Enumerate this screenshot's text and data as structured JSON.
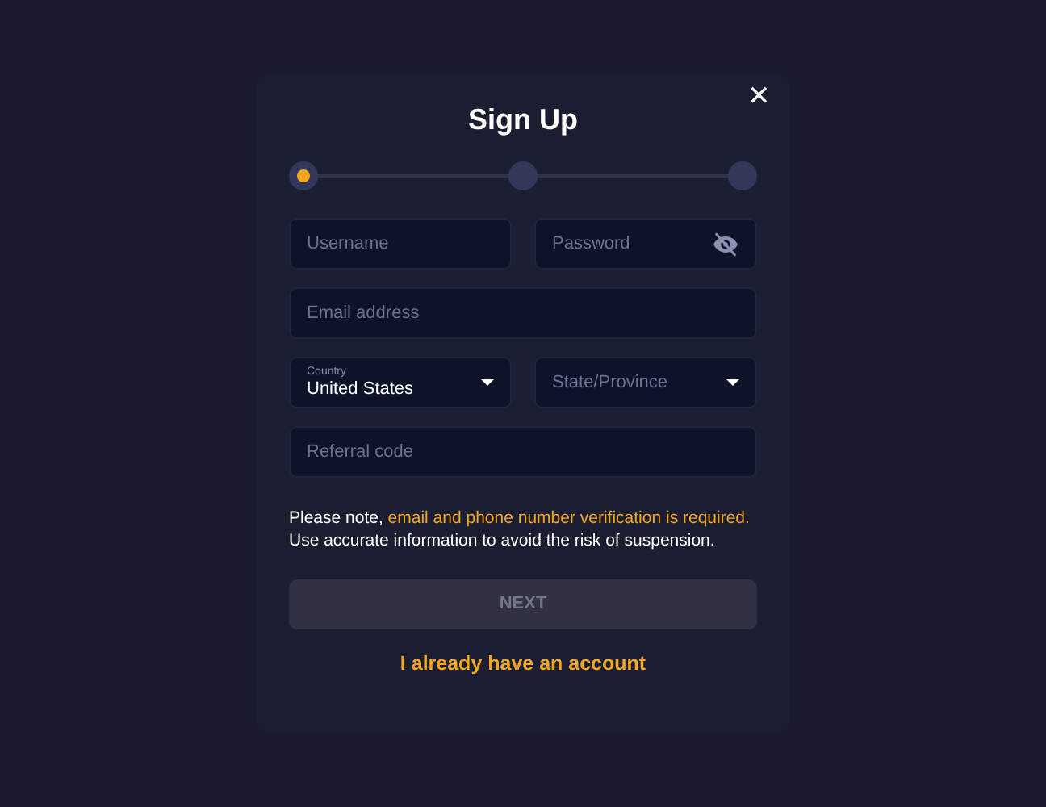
{
  "dialog": {
    "title": "Sign Up",
    "close": "✕"
  },
  "steps": [
    {
      "selected": true
    },
    {
      "selected": false
    },
    {
      "selected": false
    }
  ],
  "fields": [
    {
      "kind": "password_pair",
      "items": [
        {
          "placeholder": "Username"
        },
        {
          "placeholder": "Password",
          "password_hidden": true
        }
      ]
    },
    {
      "kind": "text",
      "placeholder": "Email address"
    },
    {
      "kind": "select_pair",
      "items": [
        {
          "label": "Country",
          "value": "United States"
        },
        {
          "placeholder": "State/Province"
        }
      ]
    },
    {
      "kind": "text",
      "placeholder": "Referral code"
    }
  ],
  "notice": {
    "before": "Please note, ",
    "highlight": "email and phone number verification is required.",
    "after": " Use accurate information to avoid the risk of suspension."
  },
  "next_button": {
    "label": "NEXT",
    "disabled": true
  },
  "login_link": "I already have an account"
}
